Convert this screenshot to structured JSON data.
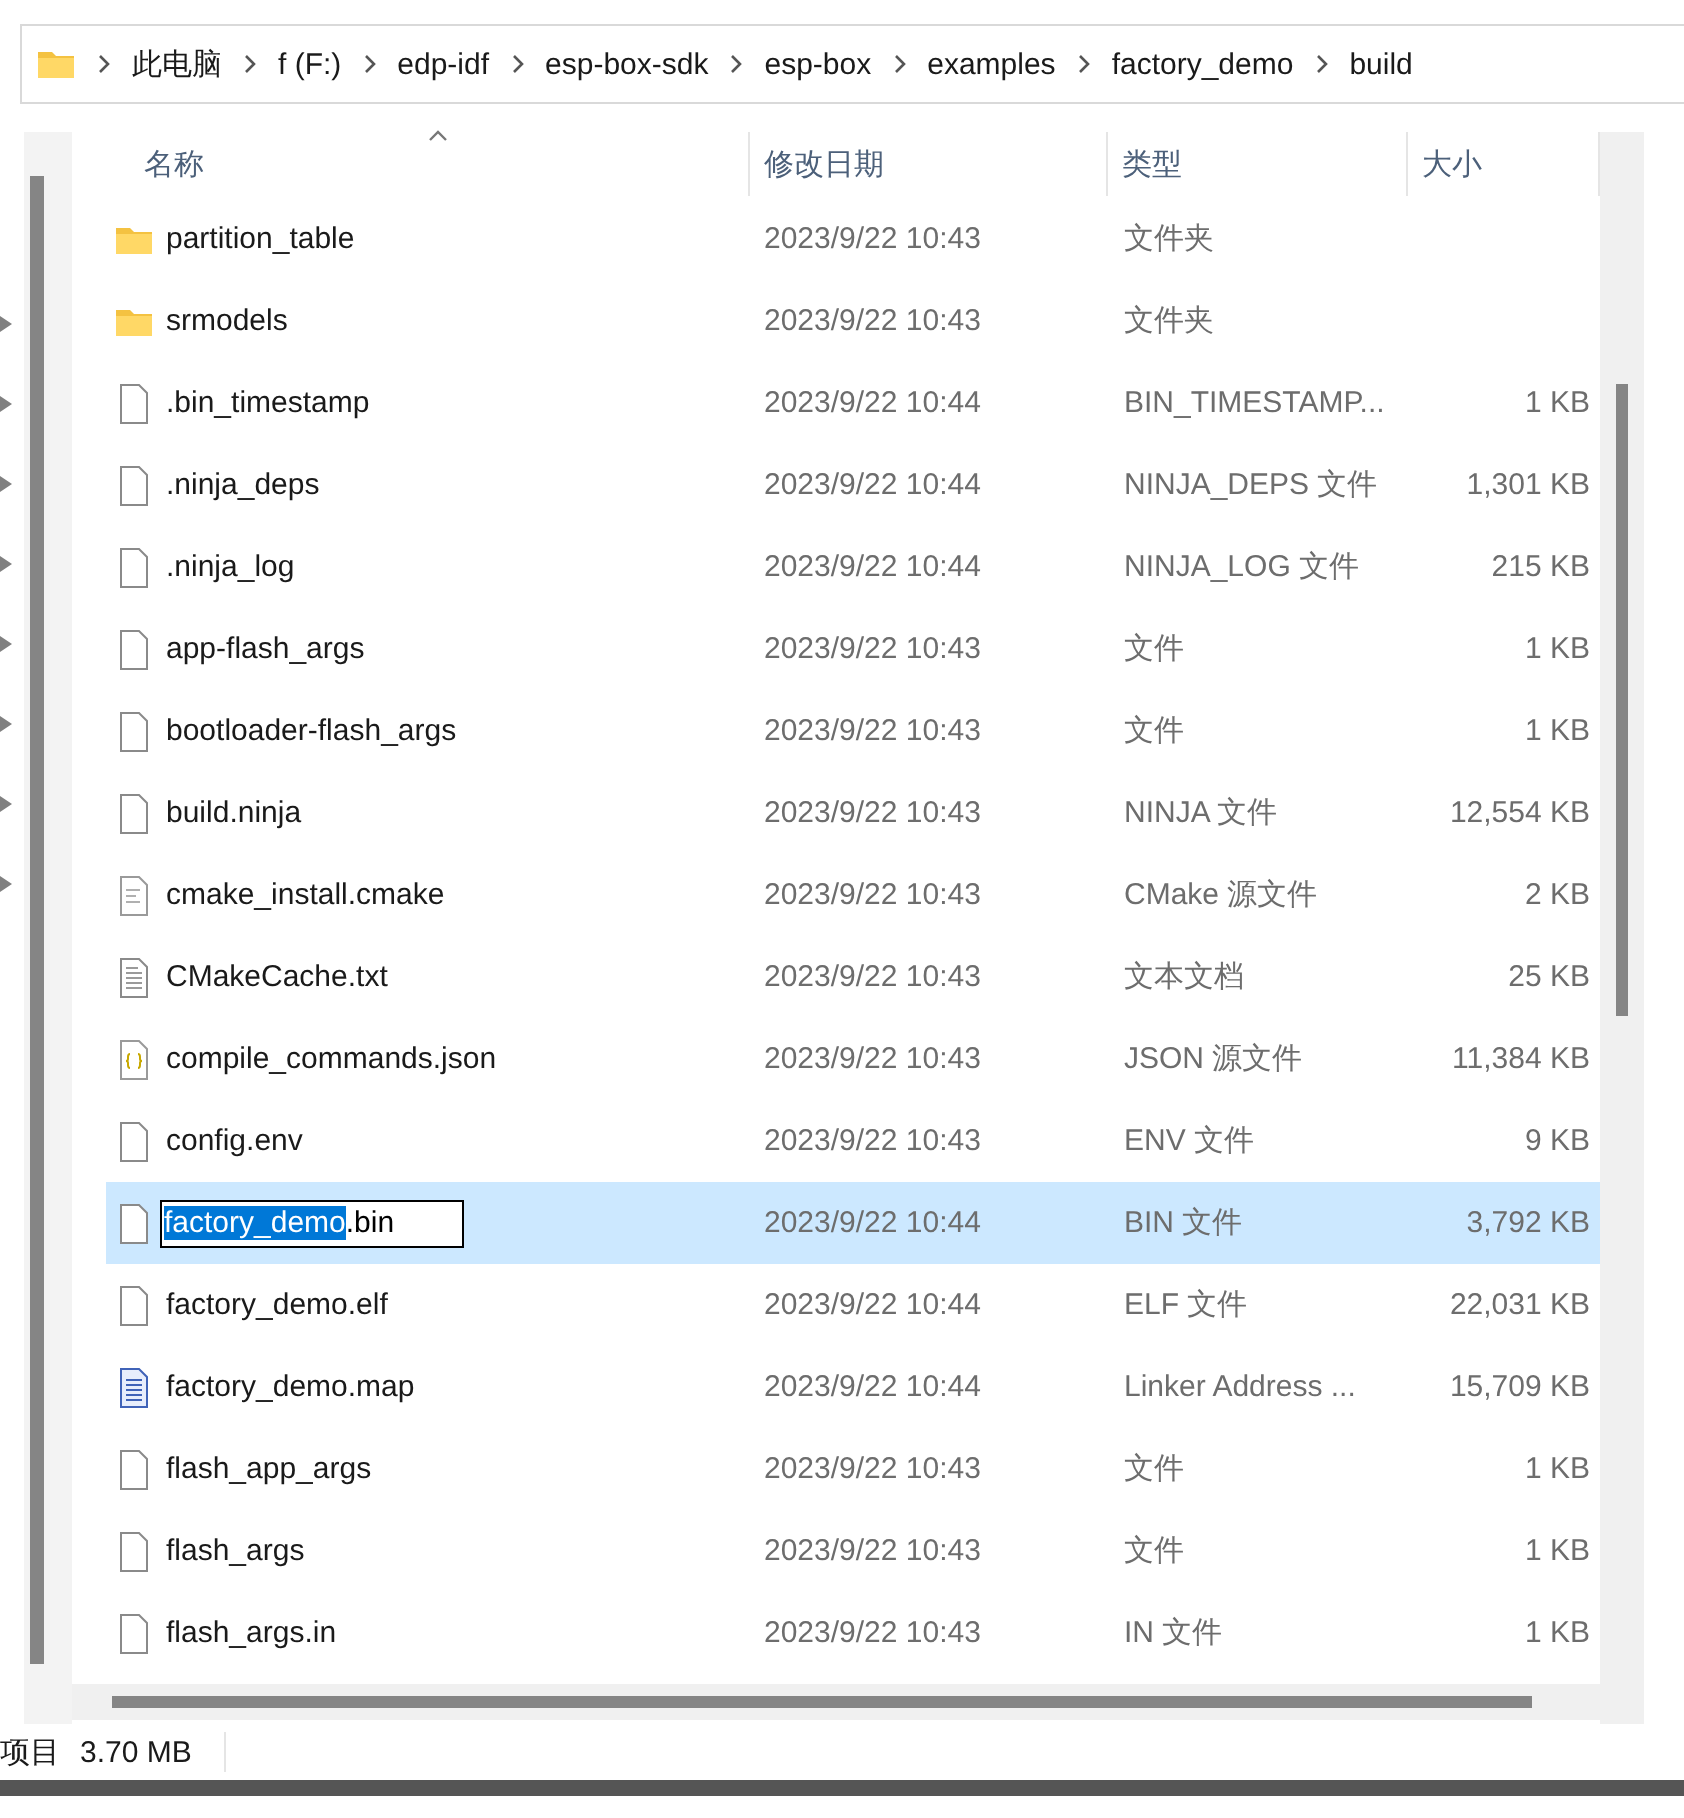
{
  "breadcrumb": [
    "此电脑",
    "f (F:)",
    "edp-idf",
    "esp-box-sdk",
    "esp-box",
    "examples",
    "factory_demo",
    "build"
  ],
  "columns": [
    "名称",
    "修改日期",
    "类型",
    "大小"
  ],
  "rows": [
    {
      "kind": "folder",
      "name": "partition_table",
      "date": "2023/9/22 10:43",
      "type": "文件夹",
      "size": "",
      "selected": false
    },
    {
      "kind": "folder",
      "name": "srmodels",
      "date": "2023/9/22 10:43",
      "type": "文件夹",
      "size": "",
      "selected": false
    },
    {
      "kind": "file",
      "name": ".bin_timestamp",
      "date": "2023/9/22 10:44",
      "type": "BIN_TIMESTAMP...",
      "size": "1 KB",
      "selected": false
    },
    {
      "kind": "file",
      "name": ".ninja_deps",
      "date": "2023/9/22 10:44",
      "type": "NINJA_DEPS 文件",
      "size": "1,301 KB",
      "selected": false
    },
    {
      "kind": "file",
      "name": ".ninja_log",
      "date": "2023/9/22 10:44",
      "type": "NINJA_LOG 文件",
      "size": "215 KB",
      "selected": false
    },
    {
      "kind": "file",
      "name": "app-flash_args",
      "date": "2023/9/22 10:43",
      "type": "文件",
      "size": "1 KB",
      "selected": false
    },
    {
      "kind": "file",
      "name": "bootloader-flash_args",
      "date": "2023/9/22 10:43",
      "type": "文件",
      "size": "1 KB",
      "selected": false
    },
    {
      "kind": "file",
      "name": "build.ninja",
      "date": "2023/9/22 10:43",
      "type": "NINJA 文件",
      "size": "12,554 KB",
      "selected": false
    },
    {
      "kind": "script",
      "name": "cmake_install.cmake",
      "date": "2023/9/22 10:43",
      "type": "CMake 源文件",
      "size": "2 KB",
      "selected": false
    },
    {
      "kind": "text",
      "name": "CMakeCache.txt",
      "date": "2023/9/22 10:43",
      "type": "文本文档",
      "size": "25 KB",
      "selected": false
    },
    {
      "kind": "json",
      "name": "compile_commands.json",
      "date": "2023/9/22 10:43",
      "type": "JSON 源文件",
      "size": "11,384 KB",
      "selected": false
    },
    {
      "kind": "file",
      "name": "config.env",
      "date": "2023/9/22 10:43",
      "type": "ENV 文件",
      "size": "9 KB",
      "selected": false
    },
    {
      "kind": "file",
      "name_parts": [
        {
          "text": "factory_demo",
          "selected": true
        },
        {
          "text": ".bin",
          "selected": false
        }
      ],
      "date": "2023/9/22 10:44",
      "type": "BIN 文件",
      "size": "3,792 KB",
      "selected": true
    },
    {
      "kind": "file",
      "name": "factory_demo.elf",
      "date": "2023/9/22 10:44",
      "type": "ELF 文件",
      "size": "22,031 KB",
      "selected": false
    },
    {
      "kind": "doc",
      "name": "factory_demo.map",
      "date": "2023/9/22 10:44",
      "type": "Linker Address ...",
      "size": "15,709 KB",
      "selected": false
    },
    {
      "kind": "file",
      "name": "flash_app_args",
      "date": "2023/9/22 10:43",
      "type": "文件",
      "size": "1 KB",
      "selected": false
    },
    {
      "kind": "file",
      "name": "flash_args",
      "date": "2023/9/22 10:43",
      "type": "文件",
      "size": "1 KB",
      "selected": false
    },
    {
      "kind": "file",
      "name": "flash_args.in",
      "date": "2023/9/22 10:43",
      "type": "IN 文件",
      "size": "1 KB",
      "selected": false
    }
  ],
  "status_bar": {
    "items": "项目",
    "selection_size": "3.70 MB"
  }
}
